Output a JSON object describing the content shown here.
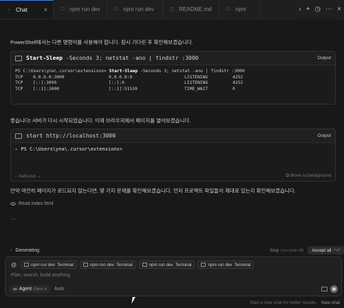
{
  "tabs": [
    {
      "label": "Chat",
      "active": true
    },
    {
      "label": "npm run dev"
    },
    {
      "label": "npm run dev"
    },
    {
      "label": "README.md"
    },
    {
      "label": "npm"
    }
  ],
  "messages": {
    "p1": "PowerShell에서는 다른 명령어를 사용해야 합니다. 잠시 기다린 후 확인해보겠습니다.",
    "p2": "좋습니다! 서버가 다시 시작되었습니다. 이제 브라우저에서 페이지를 열어보겠습니다.",
    "p3": "만약 여전히 페이지가 로드되지 않는다면, 몇 가지 문제를 확인해보겠습니다. 먼저 프로젝트 파일들이 제대로 있는지 확인해보겠습니다.",
    "read_file": "Read index.html",
    "ellipsis": "⋯"
  },
  "terminal1": {
    "cmd_name": "Start-Sleep",
    "cmd_args": " -Seconds 3; netstat -ano | findstr :3000",
    "output_label": "Output",
    "prompt": "PS C:\\Users\\yna\\.cursor\\extensions> ",
    "rows": [
      [
        "TCP",
        "0.0.0.0:3000",
        "0.0.0.0:0",
        "LISTENING",
        "4252"
      ],
      [
        "TCP",
        "[::]:3000",
        "[::]:0",
        "LISTENING",
        "4252"
      ],
      [
        "TCP",
        "[::1]:3000",
        "[::1]:51539",
        "TIME_WAIT",
        "0"
      ]
    ]
  },
  "terminal2": {
    "cmd": "start http://localhost:3000",
    "output_label": "Output",
    "prompt": "PS C:\\Users\\yna\\.cursor\\extensions>",
    "auto_run": "Auto-run",
    "move_bg": "Move to background"
  },
  "generating": {
    "label": "Generating",
    "stop": "Stop",
    "stop_shortcut": "Ctrl+Shift+⌫",
    "accept_all": "Accept all",
    "accept_shortcut": "^⏎"
  },
  "composer": {
    "chips": [
      "npm run dev",
      "npm run dev",
      "npm run dev",
      "npm run dev"
    ],
    "chip_suffix": "Terminal",
    "placeholder": "Plan, search, build anything",
    "agent_label": "Agent",
    "agent_shortcut": "Ctrl+I",
    "auto_label": "Auto"
  },
  "footer": {
    "hint": "Start a new chat for better results.",
    "new_chat": "New chat"
  },
  "colors": {
    "accent": "#3b82f6",
    "background": "#181818"
  }
}
